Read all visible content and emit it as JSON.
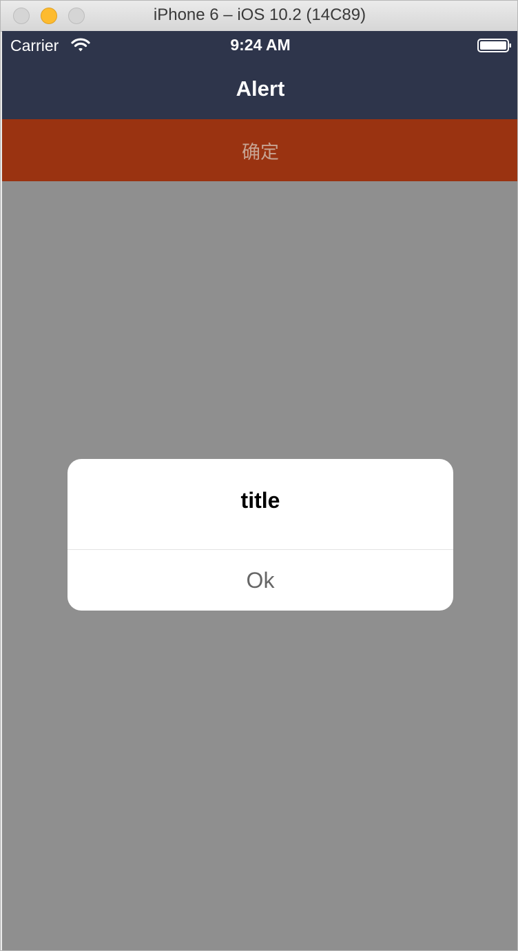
{
  "window": {
    "title": "iPhone 6 – iOS 10.2 (14C89)"
  },
  "status_bar": {
    "carrier": "Carrier",
    "time": "9:24 AM",
    "wifi_icon": "wifi-icon",
    "battery_icon": "battery-icon"
  },
  "navbar": {
    "title": "Alert",
    "background": "#2e354b"
  },
  "confirm_button": {
    "label": "确定",
    "background": "#9a3311"
  },
  "alert": {
    "title": "title",
    "ok_label": "Ok"
  },
  "overlay_color": "#8f8f8f"
}
